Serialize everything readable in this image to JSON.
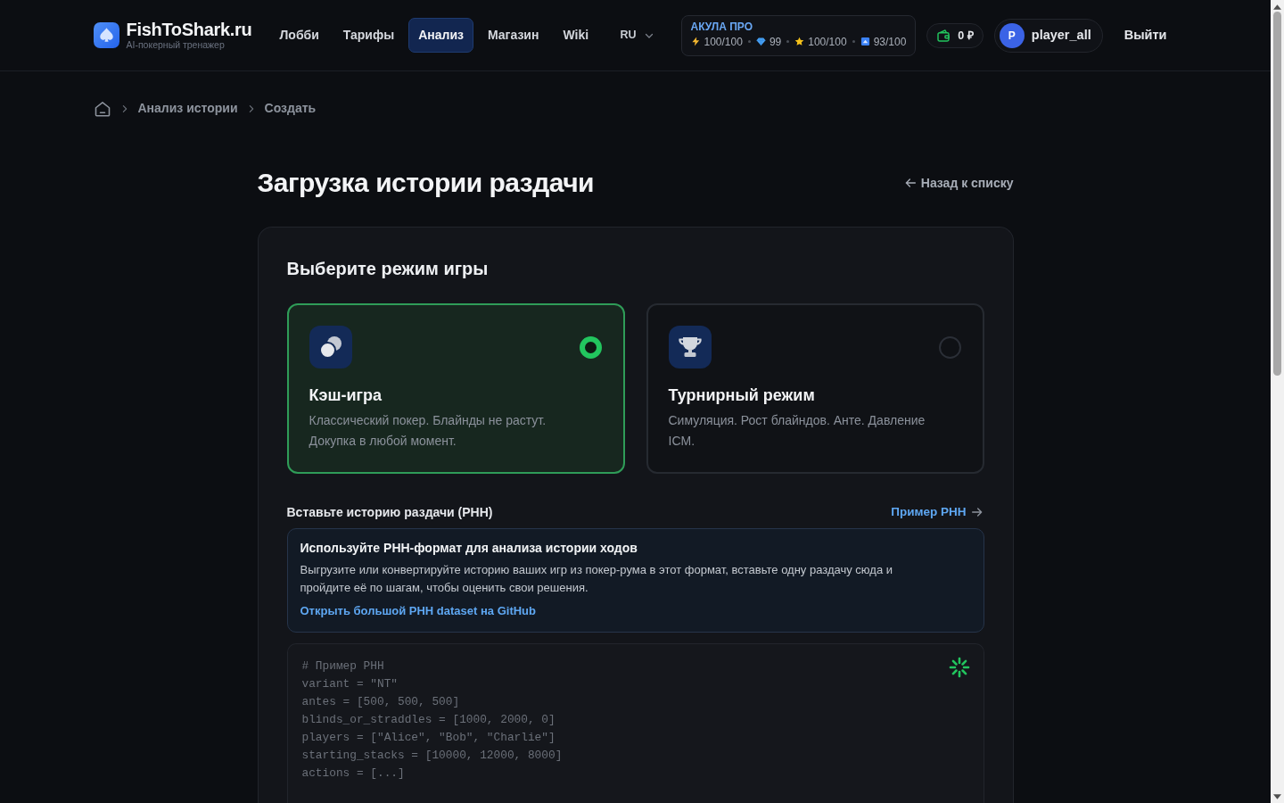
{
  "header": {
    "logo": {
      "title": "FishToShark.ru",
      "subtitle": "AI-покерный тренажер"
    },
    "nav": [
      {
        "label": "Лобби",
        "selected": false
      },
      {
        "label": "Тарифы",
        "selected": false
      },
      {
        "label": "Анализ",
        "selected": true
      },
      {
        "label": "Магазин",
        "selected": false
      },
      {
        "label": "Wiki",
        "selected": false
      }
    ],
    "language": "RU",
    "plan": {
      "name": "АКУЛА ПРО",
      "stats": [
        {
          "kind": "energy",
          "value": "100/100"
        },
        {
          "kind": "gems",
          "value": "99"
        },
        {
          "kind": "stars",
          "value": "100/100"
        },
        {
          "kind": "rank",
          "value": "93/100"
        }
      ]
    },
    "wallet": "0 ₽",
    "user": {
      "initial": "P",
      "name": "player_all"
    },
    "logout": "Выйти"
  },
  "breadcrumb": [
    "Анализ истории",
    "Создать"
  ],
  "page": {
    "title": "Загрузка истории раздачи",
    "back_link": "Назад к списку"
  },
  "modes": {
    "heading": "Выберите режим игры",
    "options": [
      {
        "kind": "cash",
        "title": "Кэш-игра",
        "description": "Классический покер. Блайнды не растут. Докупка в любой момент.",
        "selected": true
      },
      {
        "kind": "tournament",
        "title": "Турнирный режим",
        "description": "Симуляция. Рост блайндов. Анте. Давление ICM.",
        "selected": false
      }
    ]
  },
  "history": {
    "label": "Вставьте историю раздачи (PHH)",
    "example_link": "Пример PHH",
    "info": {
      "title": "Используйте PHH-формат для анализа истории ходов",
      "text": "Выгрузите или конвертируйте историю ваших игр из покер-рума в этот формат, вставьте одну раздачу сюда и пройдите её по шагам, чтобы оценить свои решения.",
      "link": "Открыть большой PHH dataset на GitHub"
    },
    "input": {
      "placeholder": "# Пример PHH\nvariant = \"NT\"\nantes = [500, 500, 500]\nblinds_or_straddles = [1000, 2000, 0]\nplayers = [\"Alice\", \"Bob\", \"Charlie\"]\nstarting_stacks = [10000, 12000, 8000]\nactions = [...]"
    }
  }
}
